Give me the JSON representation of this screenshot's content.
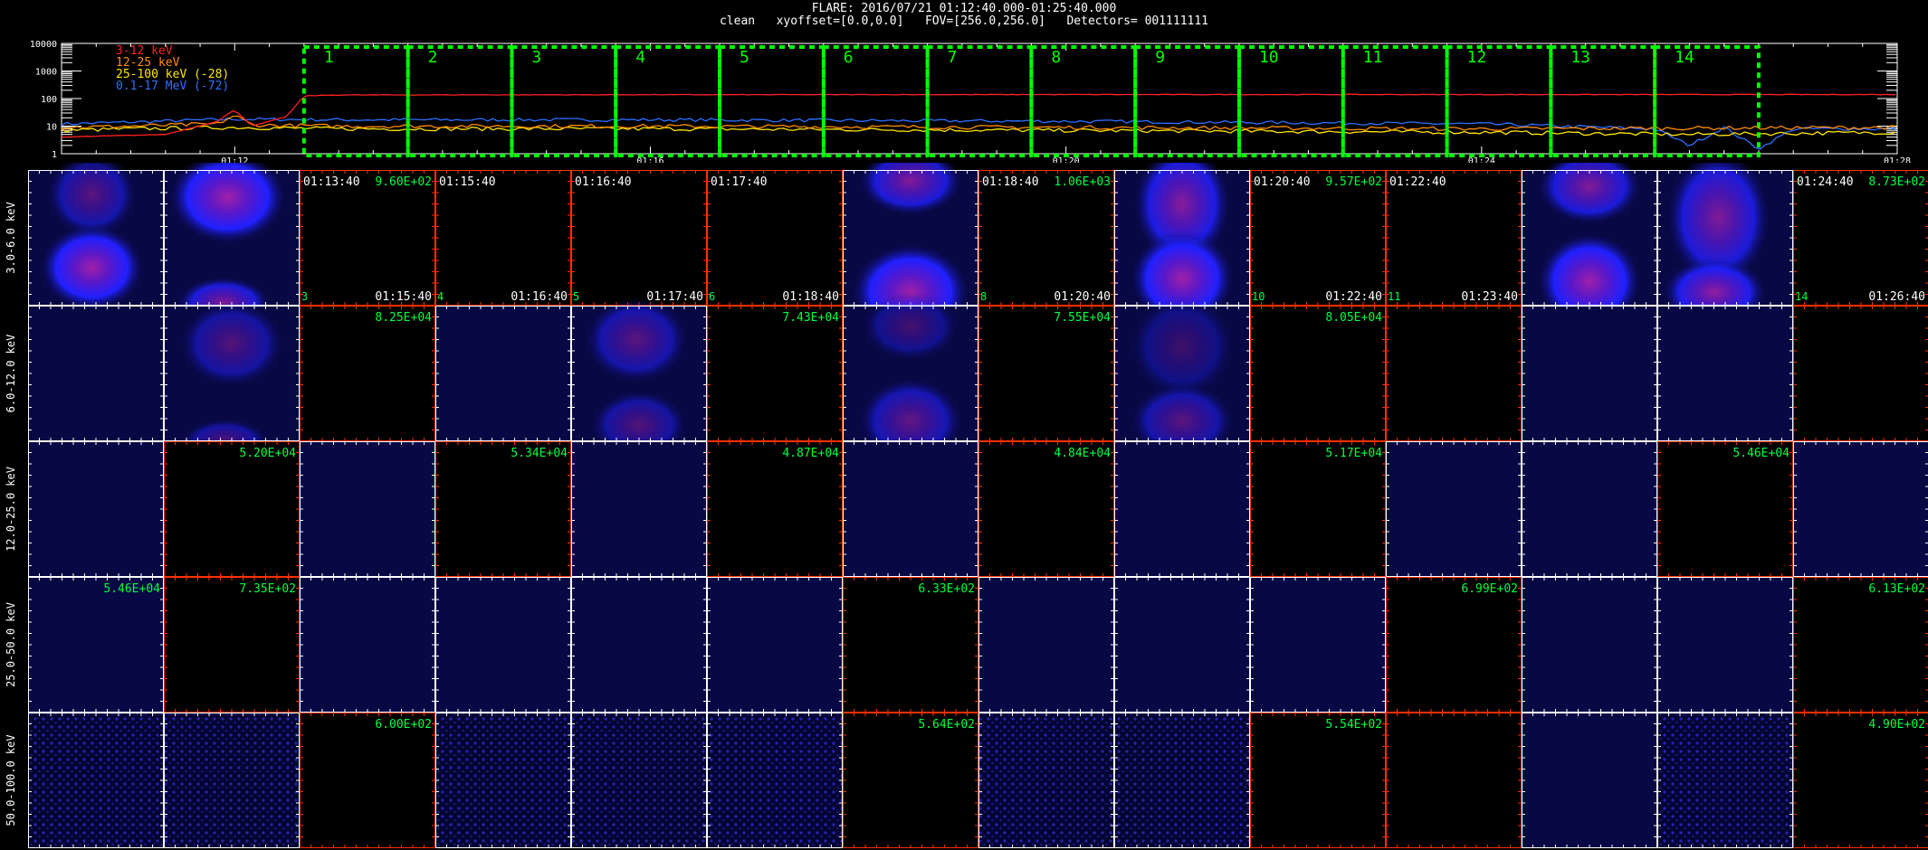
{
  "header": {
    "line1": "FLARE: 2016/07/21 01:12:40.000-01:25:40.000",
    "line2": "clean   xyoffset=[0.0,0.0]   FOV=[256.0,256.0]   Detectors= 001111111"
  },
  "colors": {
    "band_3_12": "#ff2020",
    "band_12_25": "#ff8c00",
    "band_25_100": "#ffe600",
    "band_0_1_17": "#2f6fff",
    "interval_box": "#00ff00",
    "panel_frame_white": "#ffffff",
    "panel_frame_red": "#ff3000",
    "annotation": "#00ff40"
  },
  "chart_data": [
    {
      "type": "line",
      "yscale": "log",
      "ylim": [
        1,
        10000
      ],
      "ytick_labels": [
        "10000",
        "1000",
        "100",
        "10",
        "1"
      ],
      "xlim": [
        "01:10:20",
        "01:28:00"
      ],
      "xtick_labels": [
        {
          "t": "01:12:00",
          "label": "01:12"
        },
        {
          "t": "01:16:00",
          "label": "01:16"
        },
        {
          "t": "01:20:00",
          "label": "01:20"
        },
        {
          "t": "01:24:00",
          "label": "01:24"
        },
        {
          "t": "01:28:00",
          "label": "01:28"
        }
      ],
      "series": [
        {
          "name": "3-12 keV",
          "color_key": "band_3_12",
          "points": [
            [
              "01:10:20",
              4
            ],
            [
              "01:11:20",
              5
            ],
            [
              "01:11:50",
              15
            ],
            [
              "01:12:00",
              40
            ],
            [
              "01:12:10",
              10
            ],
            [
              "01:12:30",
              22
            ],
            [
              "01:12:40",
              125
            ],
            [
              "01:13:00",
              135
            ],
            [
              "01:16:00",
              138
            ],
            [
              "01:20:00",
              140
            ],
            [
              "01:24:00",
              140
            ],
            [
              "01:28:00",
              140
            ]
          ]
        },
        {
          "name": "12-25 keV",
          "color_key": "band_12_25",
          "points": [
            [
              "01:10:20",
              9
            ],
            [
              "01:11:00",
              10
            ],
            [
              "01:11:50",
              12
            ],
            [
              "01:12:00",
              25
            ],
            [
              "01:12:10",
              11
            ],
            [
              "01:13:00",
              10
            ],
            [
              "01:16:00",
              10
            ],
            [
              "01:20:00",
              9
            ],
            [
              "01:24:00",
              8
            ],
            [
              "01:28:00",
              9
            ]
          ]
        },
        {
          "name": "25-100 keV (-28)",
          "color_key": "band_25_100",
          "points": [
            [
              "01:10:20",
              7
            ],
            [
              "01:11:00",
              8
            ],
            [
              "01:12:00",
              9
            ],
            [
              "01:13:00",
              8
            ],
            [
              "01:16:00",
              8
            ],
            [
              "01:20:00",
              7
            ],
            [
              "01:24:00",
              6
            ],
            [
              "01:26:00",
              5
            ],
            [
              "01:28:00",
              6
            ]
          ]
        },
        {
          "name": "0.1-17 MeV (-72)",
          "color_key": "band_0_1_17",
          "points": [
            [
              "01:10:20",
              12
            ],
            [
              "01:11:00",
              14
            ],
            [
              "01:12:00",
              18
            ],
            [
              "01:13:00",
              17
            ],
            [
              "01:16:00",
              17
            ],
            [
              "01:20:00",
              15
            ],
            [
              "01:24:00",
              12
            ],
            [
              "01:25:40",
              8
            ],
            [
              "01:26:00",
              2
            ],
            [
              "01:26:20",
              9
            ],
            [
              "01:26:40",
              1.5
            ],
            [
              "01:27:00",
              8
            ],
            [
              "01:28:00",
              8
            ]
          ]
        }
      ],
      "intervals": [
        {
          "label": "1",
          "start": "01:12:40",
          "end": "01:13:40"
        },
        {
          "label": "2",
          "start": "01:13:40",
          "end": "01:14:40"
        },
        {
          "label": "3",
          "start": "01:14:40",
          "end": "01:15:40"
        },
        {
          "label": "4",
          "start": "01:15:40",
          "end": "01:16:40"
        },
        {
          "label": "5",
          "start": "01:16:40",
          "end": "01:17:40"
        },
        {
          "label": "6",
          "start": "01:17:40",
          "end": "01:18:40"
        },
        {
          "label": "7",
          "start": "01:18:40",
          "end": "01:19:40"
        },
        {
          "label": "8",
          "start": "01:19:40",
          "end": "01:20:40"
        },
        {
          "label": "9",
          "start": "01:20:40",
          "end": "01:21:40"
        },
        {
          "label": "10",
          "start": "01:21:40",
          "end": "01:22:40"
        },
        {
          "label": "11",
          "start": "01:22:40",
          "end": "01:23:40"
        },
        {
          "label": "12",
          "start": "01:23:40",
          "end": "01:24:40"
        },
        {
          "label": "13",
          "start": "01:24:40",
          "end": "01:25:40"
        },
        {
          "label": "14",
          "start": "01:25:40",
          "end": "01:26:40"
        }
      ]
    },
    {
      "type": "heatmap",
      "colormap": "black-blue-magenta",
      "row_labels": [
        "3.0-6.0 keV",
        "6.0-12.0 keV",
        "12.0-25.0 keV",
        "25.0-50.0 keV",
        "50.0-100.0 keV"
      ],
      "columns": 14,
      "top_row_annotations": [
        {
          "col": 0,
          "index": "",
          "start": "",
          "end": ""
        },
        {
          "col": 1,
          "index": "",
          "start": "",
          "end": ""
        },
        {
          "col": 2,
          "index": "3",
          "start": "01:13:40",
          "end": "01:15:40",
          "peak": "9.60E+02"
        },
        {
          "col": 3,
          "index": "4",
          "start": "01:15:40",
          "end": "01:16:40"
        },
        {
          "col": 4,
          "index": "5",
          "start": "01:16:40",
          "end": "01:17:40"
        },
        {
          "col": 5,
          "index": "6",
          "start": "01:17:40",
          "end": "01:18:40"
        },
        {
          "col": 6,
          "index": "",
          "start": "",
          "end": ""
        },
        {
          "col": 7,
          "index": "8",
          "start": "01:18:40",
          "end": "01:20:40",
          "peak": "1.06E+03"
        },
        {
          "col": 8,
          "index": "",
          "start": "",
          "end": ""
        },
        {
          "col": 9,
          "index": "10",
          "start": "01:20:40",
          "end": "01:22:40",
          "peak": "9.57E+02"
        },
        {
          "col": 10,
          "index": "11",
          "start": "01:22:40",
          "end": "01:23:40"
        },
        {
          "col": 11,
          "index": "",
          "start": "",
          "end": ""
        },
        {
          "col": 12,
          "index": "",
          "start": "",
          "end": ""
        },
        {
          "col": 13,
          "index": "14",
          "start": "01:24:40",
          "end": "01:26:40",
          "peak": "8.73E+02"
        }
      ],
      "peak_labels": [
        {
          "row": 1,
          "col": 2,
          "text": "8.25E+04"
        },
        {
          "row": 1,
          "col": 5,
          "text": "7.43E+04"
        },
        {
          "row": 1,
          "col": 7,
          "text": "7.55E+04"
        },
        {
          "row": 1,
          "col": 9,
          "text": "8.05E+04"
        },
        {
          "row": 2,
          "col": 1,
          "text": "5.20E+04"
        },
        {
          "row": 2,
          "col": 3,
          "text": "5.34E+04"
        },
        {
          "row": 2,
          "col": 5,
          "text": "4.87E+04"
        },
        {
          "row": 2,
          "col": 7,
          "text": "4.84E+04"
        },
        {
          "row": 2,
          "col": 9,
          "text": "5.17E+04"
        },
        {
          "row": 2,
          "col": 12,
          "text": "5.46E+04"
        },
        {
          "row": 3,
          "col": 0,
          "text": "5.46E+04"
        },
        {
          "row": 3,
          "col": 1,
          "text": "7.35E+02"
        },
        {
          "row": 3,
          "col": 6,
          "text": "6.33E+02"
        },
        {
          "row": 3,
          "col": 10,
          "text": "6.99E+02"
        },
        {
          "row": 3,
          "col": 13,
          "text": "6.13E+02"
        },
        {
          "row": 4,
          "col": 2,
          "text": "6.00E+02"
        },
        {
          "row": 4,
          "col": 6,
          "text": "5.64E+02"
        },
        {
          "row": 4,
          "col": 9,
          "text": "5.54E+02"
        },
        {
          "row": 4,
          "col": 13,
          "text": "4.90E+02"
        }
      ],
      "red_frame_cells": [
        [
          0,
          2
        ],
        [
          0,
          3
        ],
        [
          0,
          4
        ],
        [
          0,
          5
        ],
        [
          0,
          7
        ],
        [
          0,
          9
        ],
        [
          0,
          10
        ],
        [
          0,
          13
        ],
        [
          1,
          2
        ],
        [
          1,
          5
        ],
        [
          1,
          7
        ],
        [
          1,
          9
        ],
        [
          1,
          10
        ],
        [
          1,
          13
        ],
        [
          2,
          1
        ],
        [
          2,
          3
        ],
        [
          2,
          5
        ],
        [
          2,
          7
        ],
        [
          2,
          9
        ],
        [
          2,
          12
        ],
        [
          3,
          1
        ],
        [
          3,
          6
        ],
        [
          3,
          10
        ],
        [
          3,
          13
        ],
        [
          4,
          2
        ],
        [
          4,
          6
        ],
        [
          4,
          9
        ],
        [
          4,
          10
        ],
        [
          4,
          13
        ]
      ],
      "images": [
        {
          "row": 0,
          "col": 0,
          "blobs": [
            {
              "cx": 0.47,
              "cy": 0.18,
              "rx": 0.26,
              "ry": 0.25,
              "peak": 0.55
            },
            {
              "cx": 0.47,
              "cy": 0.72,
              "rx": 0.3,
              "ry": 0.25,
              "peak": 1.0
            }
          ]
        },
        {
          "row": 0,
          "col": 1,
          "blobs": [
            {
              "cx": 0.47,
              "cy": 0.2,
              "rx": 0.34,
              "ry": 0.27,
              "peak": 1.0
            },
            {
              "cx": 0.44,
              "cy": 0.98,
              "rx": 0.27,
              "ry": 0.15,
              "peak": 0.8
            }
          ]
        },
        {
          "row": 0,
          "col": 6,
          "blobs": [
            {
              "cx": 0.5,
              "cy": 0.08,
              "rx": 0.3,
              "ry": 0.2,
              "peak": 0.8
            },
            {
              "cx": 0.5,
              "cy": 0.9,
              "rx": 0.34,
              "ry": 0.28,
              "peak": 1.0
            }
          ]
        },
        {
          "row": 0,
          "col": 8,
          "blobs": [
            {
              "cx": 0.5,
              "cy": 0.25,
              "rx": 0.28,
              "ry": 0.35,
              "peak": 0.85
            },
            {
              "cx": 0.5,
              "cy": 0.8,
              "rx": 0.3,
              "ry": 0.28,
              "peak": 1.0
            }
          ]
        },
        {
          "row": 0,
          "col": 11,
          "blobs": [
            {
              "cx": 0.5,
              "cy": 0.12,
              "rx": 0.3,
              "ry": 0.22,
              "peak": 0.8
            },
            {
              "cx": 0.5,
              "cy": 0.82,
              "rx": 0.3,
              "ry": 0.28,
              "peak": 1.0
            }
          ]
        },
        {
          "row": 0,
          "col": 12,
          "blobs": [
            {
              "cx": 0.45,
              "cy": 0.35,
              "rx": 0.3,
              "ry": 0.4,
              "peak": 0.8
            },
            {
              "cx": 0.42,
              "cy": 0.9,
              "rx": 0.3,
              "ry": 0.2,
              "peak": 0.9
            }
          ]
        },
        {
          "row": 1,
          "col": 0,
          "blobs": []
        },
        {
          "row": 1,
          "col": 1,
          "blobs": [
            {
              "cx": 0.5,
              "cy": 0.28,
              "rx": 0.3,
              "ry": 0.25,
              "peak": 0.5
            },
            {
              "cx": 0.45,
              "cy": 1.0,
              "rx": 0.25,
              "ry": 0.13,
              "peak": 0.5
            }
          ]
        },
        {
          "row": 1,
          "col": 3,
          "blobs": []
        },
        {
          "row": 1,
          "col": 4,
          "blobs": [
            {
              "cx": 0.48,
              "cy": 0.25,
              "rx": 0.3,
              "ry": 0.25,
              "peak": 0.55
            },
            {
              "cx": 0.5,
              "cy": 0.88,
              "rx": 0.28,
              "ry": 0.2,
              "peak": 0.5
            }
          ]
        },
        {
          "row": 1,
          "col": 6,
          "blobs": [
            {
              "cx": 0.5,
              "cy": 0.15,
              "rx": 0.28,
              "ry": 0.2,
              "peak": 0.4
            },
            {
              "cx": 0.5,
              "cy": 0.85,
              "rx": 0.3,
              "ry": 0.25,
              "peak": 0.6
            }
          ]
        },
        {
          "row": 1,
          "col": 8,
          "blobs": [
            {
              "cx": 0.5,
              "cy": 0.3,
              "rx": 0.3,
              "ry": 0.3,
              "peak": 0.35
            },
            {
              "cx": 0.5,
              "cy": 0.85,
              "rx": 0.3,
              "ry": 0.22,
              "peak": 0.55
            }
          ]
        },
        {
          "row": 1,
          "col": 11,
          "blobs": []
        },
        {
          "row": 1,
          "col": 12,
          "blobs": []
        }
      ],
      "faint_cells": [
        [
          1,
          0
        ],
        [
          1,
          3
        ],
        [
          1,
          11
        ],
        [
          1,
          12
        ],
        [
          2,
          0
        ],
        [
          2,
          2
        ],
        [
          2,
          4
        ],
        [
          2,
          6
        ],
        [
          2,
          8
        ],
        [
          2,
          10
        ],
        [
          2,
          11
        ],
        [
          2,
          13
        ],
        [
          3,
          0
        ],
        [
          3,
          2
        ],
        [
          3,
          3
        ],
        [
          3,
          4
        ],
        [
          3,
          5
        ],
        [
          3,
          7
        ],
        [
          3,
          8
        ],
        [
          3,
          9
        ],
        [
          3,
          11
        ],
        [
          3,
          12
        ],
        [
          4,
          11
        ]
      ],
      "speckled_cells": [
        [
          4,
          0
        ],
        [
          4,
          1
        ],
        [
          4,
          3
        ],
        [
          4,
          4
        ],
        [
          4,
          5
        ],
        [
          4,
          7
        ],
        [
          4,
          8
        ],
        [
          4,
          12
        ]
      ]
    }
  ]
}
